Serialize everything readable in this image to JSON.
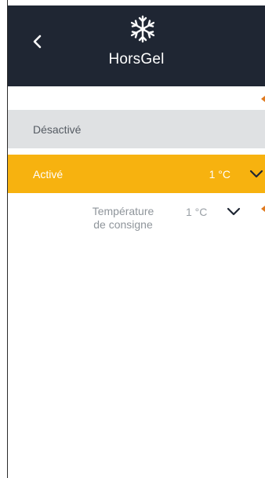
{
  "header": {
    "title": "HorsGel",
    "icon": "snowflake-icon",
    "back_icon": "chevron-left-icon",
    "background": "#1f2633"
  },
  "options": [
    {
      "label": "Désactivé",
      "selected": false
    },
    {
      "label": "Activé",
      "value": "1 °C",
      "selected": true
    }
  ],
  "setpoint": {
    "label_line1": "Température",
    "label_line2": "de consigne",
    "value": "1 °C"
  },
  "colors": {
    "accent": "#f7b20f",
    "unselected_row": "#dfe1e3",
    "marker": "#e07a1f"
  }
}
